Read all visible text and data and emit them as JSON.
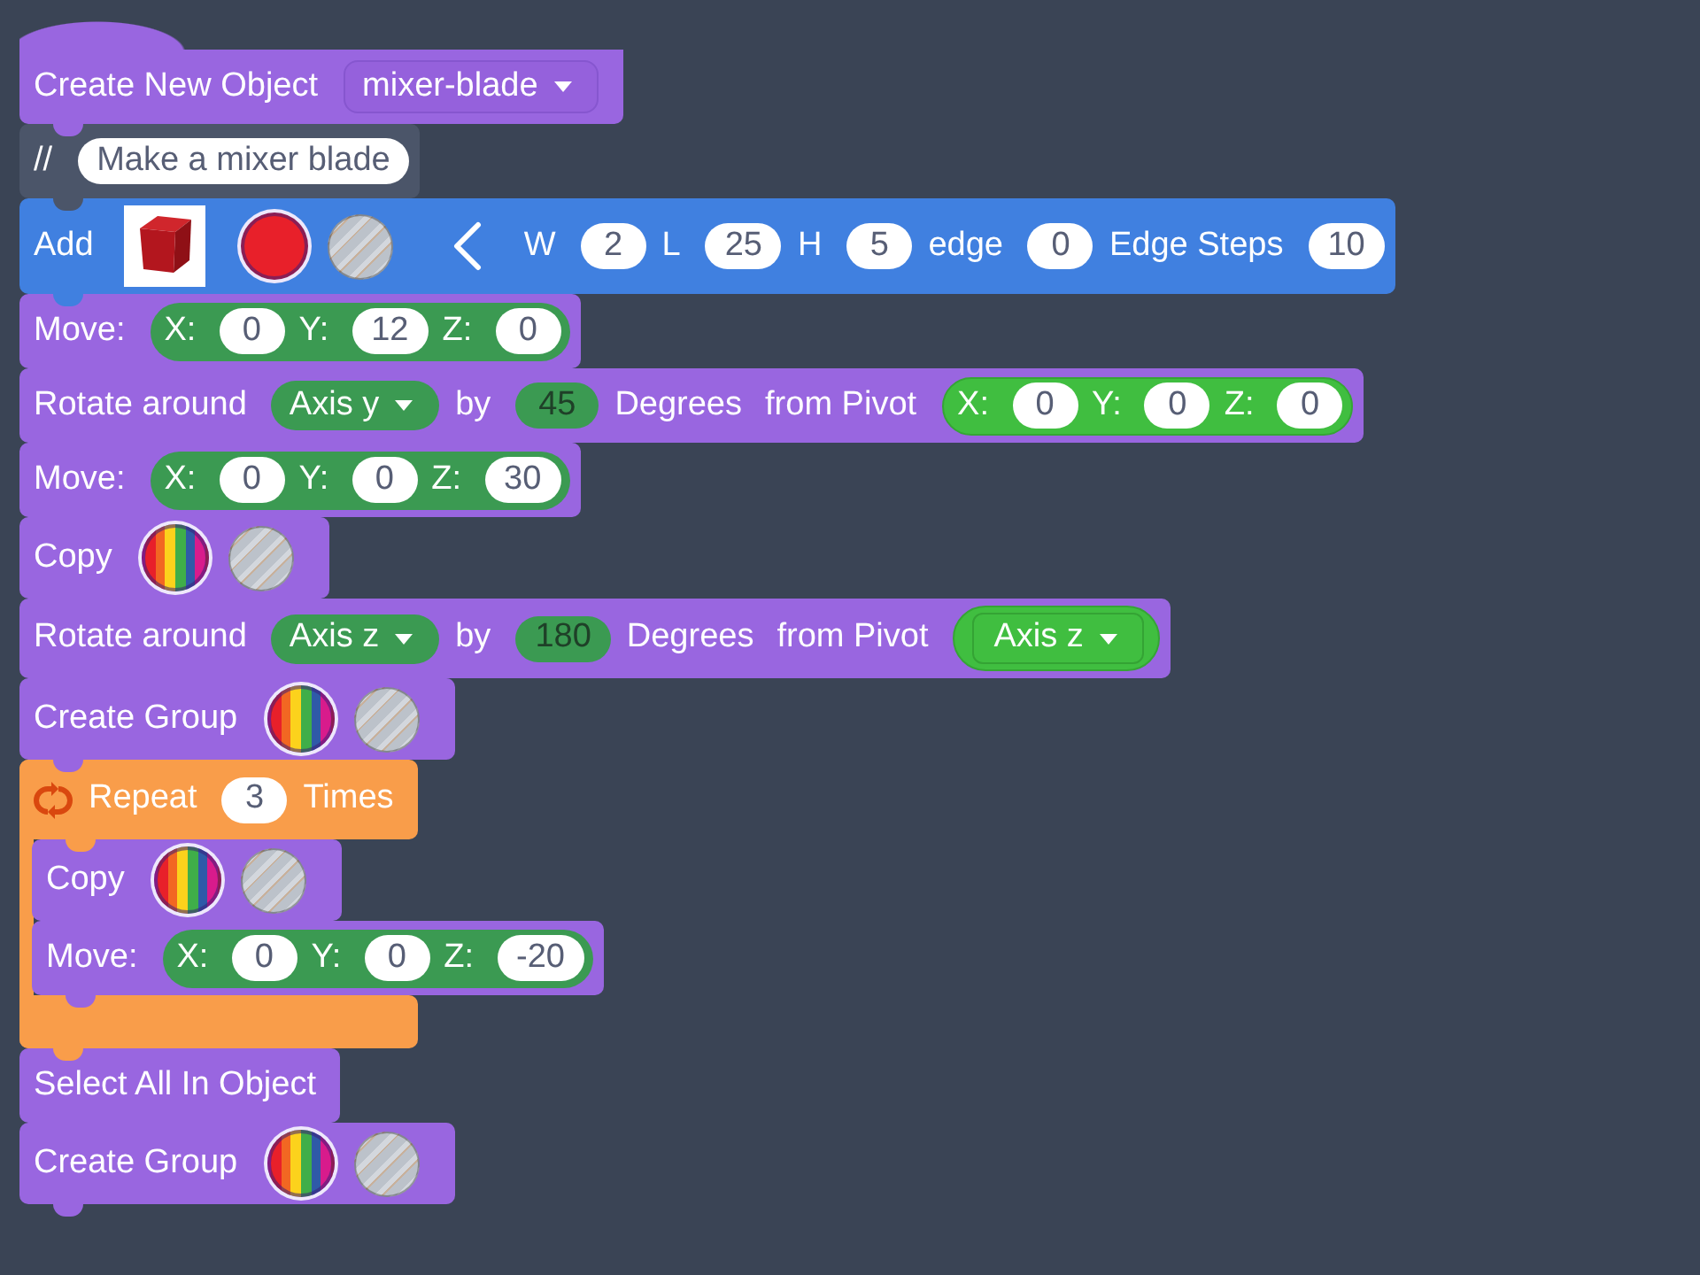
{
  "blocks": [
    {
      "kind": "hat",
      "parts": [
        {
          "kind": "label",
          "text": "Create New Object"
        },
        {
          "kind": "menu",
          "value": "mixer-blade"
        }
      ]
    },
    {
      "kind": "comment",
      "parts": [
        {
          "kind": "label",
          "text": "//"
        },
        {
          "kind": "field",
          "value": "Make a mixer blade"
        }
      ]
    },
    {
      "kind": "shape",
      "parts": [
        {
          "kind": "label",
          "text": "Add"
        },
        {
          "kind": "preview"
        },
        {
          "kind": "swatch",
          "color": "#e8202a",
          "selected": true
        },
        {
          "kind": "hole",
          "selected": false
        },
        {
          "kind": "collapse"
        },
        {
          "kind": "label",
          "text": "W"
        },
        {
          "kind": "field",
          "value": "2"
        },
        {
          "kind": "label",
          "text": "L"
        },
        {
          "kind": "field",
          "value": "25"
        },
        {
          "kind": "label",
          "text": "H"
        },
        {
          "kind": "field",
          "value": "5"
        },
        {
          "kind": "label",
          "text": "edge"
        },
        {
          "kind": "field",
          "value": "0"
        },
        {
          "kind": "label",
          "text": "Edge Steps"
        },
        {
          "kind": "field",
          "value": "10"
        }
      ]
    },
    {
      "kind": "action",
      "parts": [
        {
          "kind": "label",
          "text": "Move:"
        },
        {
          "kind": "vector",
          "axes": [
            {
              "label": "X:",
              "value": "0"
            },
            {
              "label": "Y:",
              "value": "12"
            },
            {
              "label": "Z:",
              "value": "0"
            }
          ]
        }
      ]
    },
    {
      "kind": "action",
      "parts": [
        {
          "kind": "label",
          "text": "Rotate around"
        },
        {
          "kind": "axis",
          "value": "Axis y"
        },
        {
          "kind": "label",
          "text": "by"
        },
        {
          "kind": "dimfield",
          "value": "45"
        },
        {
          "kind": "label",
          "text": "Degrees"
        },
        {
          "kind": "label",
          "text": "from Pivot"
        },
        {
          "kind": "pivot",
          "axes": [
            {
              "label": "X:",
              "value": "0"
            },
            {
              "label": "Y:",
              "value": "0"
            },
            {
              "label": "Z:",
              "value": "0"
            }
          ]
        }
      ]
    },
    {
      "kind": "action",
      "parts": [
        {
          "kind": "label",
          "text": "Move:"
        },
        {
          "kind": "vector",
          "axes": [
            {
              "label": "X:",
              "value": "0"
            },
            {
              "label": "Y:",
              "value": "0"
            },
            {
              "label": "Z:",
              "value": "30"
            }
          ]
        }
      ]
    },
    {
      "kind": "action",
      "parts": [
        {
          "kind": "label",
          "text": "Copy"
        },
        {
          "kind": "multicolor",
          "selected": true
        },
        {
          "kind": "hole",
          "selected": false
        }
      ]
    },
    {
      "kind": "action",
      "parts": [
        {
          "kind": "label",
          "text": "Rotate around"
        },
        {
          "kind": "axis",
          "value": "Axis z"
        },
        {
          "kind": "label",
          "text": "by"
        },
        {
          "kind": "dimfield",
          "value": "180"
        },
        {
          "kind": "label",
          "text": "Degrees"
        },
        {
          "kind": "label",
          "text": "from Pivot"
        },
        {
          "kind": "pivotaxis",
          "value": "Axis z"
        }
      ]
    },
    {
      "kind": "action",
      "parts": [
        {
          "kind": "label",
          "text": "Create Group"
        },
        {
          "kind": "multicolor",
          "selected": true
        },
        {
          "kind": "hole",
          "selected": false
        }
      ]
    },
    {
      "kind": "loop",
      "parts": [
        {
          "kind": "loopicon"
        },
        {
          "kind": "label",
          "text": "Repeat"
        },
        {
          "kind": "field",
          "value": "3"
        },
        {
          "kind": "label",
          "text": "Times"
        }
      ],
      "children": [
        {
          "kind": "action",
          "parts": [
            {
              "kind": "label",
              "text": "Copy"
            },
            {
              "kind": "multicolor",
              "selected": true
            },
            {
              "kind": "hole",
              "selected": false
            }
          ]
        },
        {
          "kind": "action",
          "parts": [
            {
              "kind": "label",
              "text": "Move:"
            },
            {
              "kind": "vector",
              "axes": [
                {
                  "label": "X:",
                  "value": "0"
                },
                {
                  "label": "Y:",
                  "value": "0"
                },
                {
                  "label": "Z:",
                  "value": "-20"
                }
              ]
            }
          ]
        }
      ]
    },
    {
      "kind": "action",
      "parts": [
        {
          "kind": "label",
          "text": "Select All In Object"
        }
      ]
    },
    {
      "kind": "action",
      "parts": [
        {
          "kind": "label",
          "text": "Create Group"
        },
        {
          "kind": "multicolor",
          "selected": true
        },
        {
          "kind": "hole",
          "selected": false
        }
      ]
    }
  ]
}
